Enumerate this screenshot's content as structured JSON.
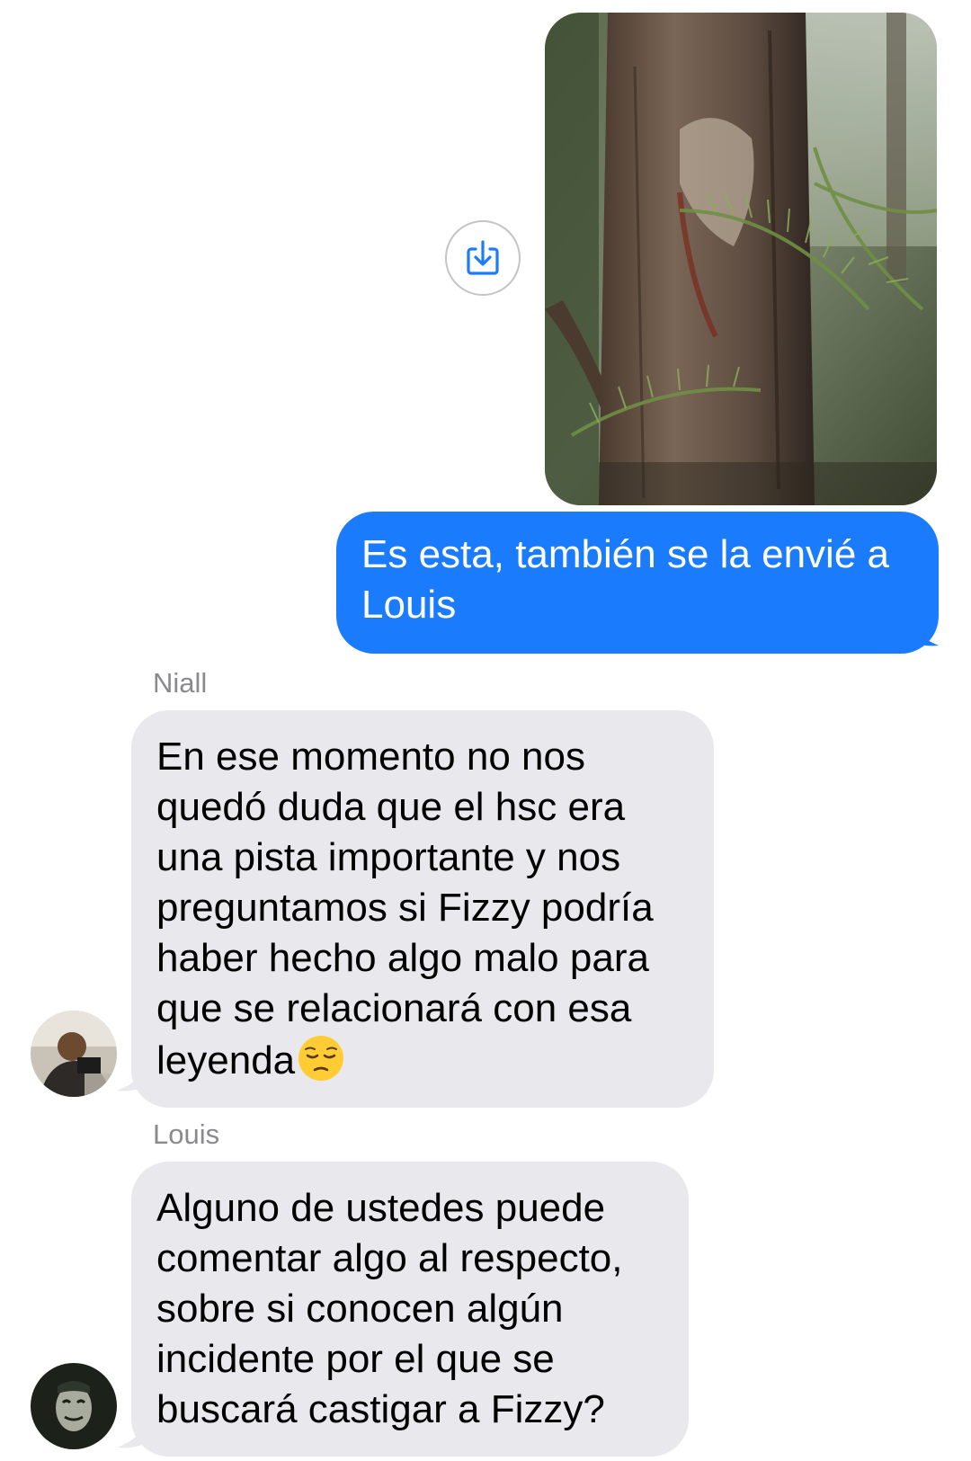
{
  "colors": {
    "sent_bubble": "#1a7cfd",
    "received_bubble": "#e8e8ed",
    "sender_name": "#8a8a8e"
  },
  "attachment": {
    "share_icon": "share-download-icon"
  },
  "messages": {
    "sent_1": {
      "text": "Es esta, también se la envié a Louis"
    },
    "niall": {
      "sender": "Niall",
      "text": "En ese momento no nos quedó duda que el hsc era una pista importante y nos preguntamos si Fizzy podría haber hecho algo malo para que se relacionará con esa leyenda",
      "emoji": "pensive-face-emoji"
    },
    "louis": {
      "sender": "Louis",
      "text": "Alguno de ustedes puede comentar algo al respecto, sobre si conocen algún incidente por el que se buscará castigar a Fizzy?"
    }
  }
}
